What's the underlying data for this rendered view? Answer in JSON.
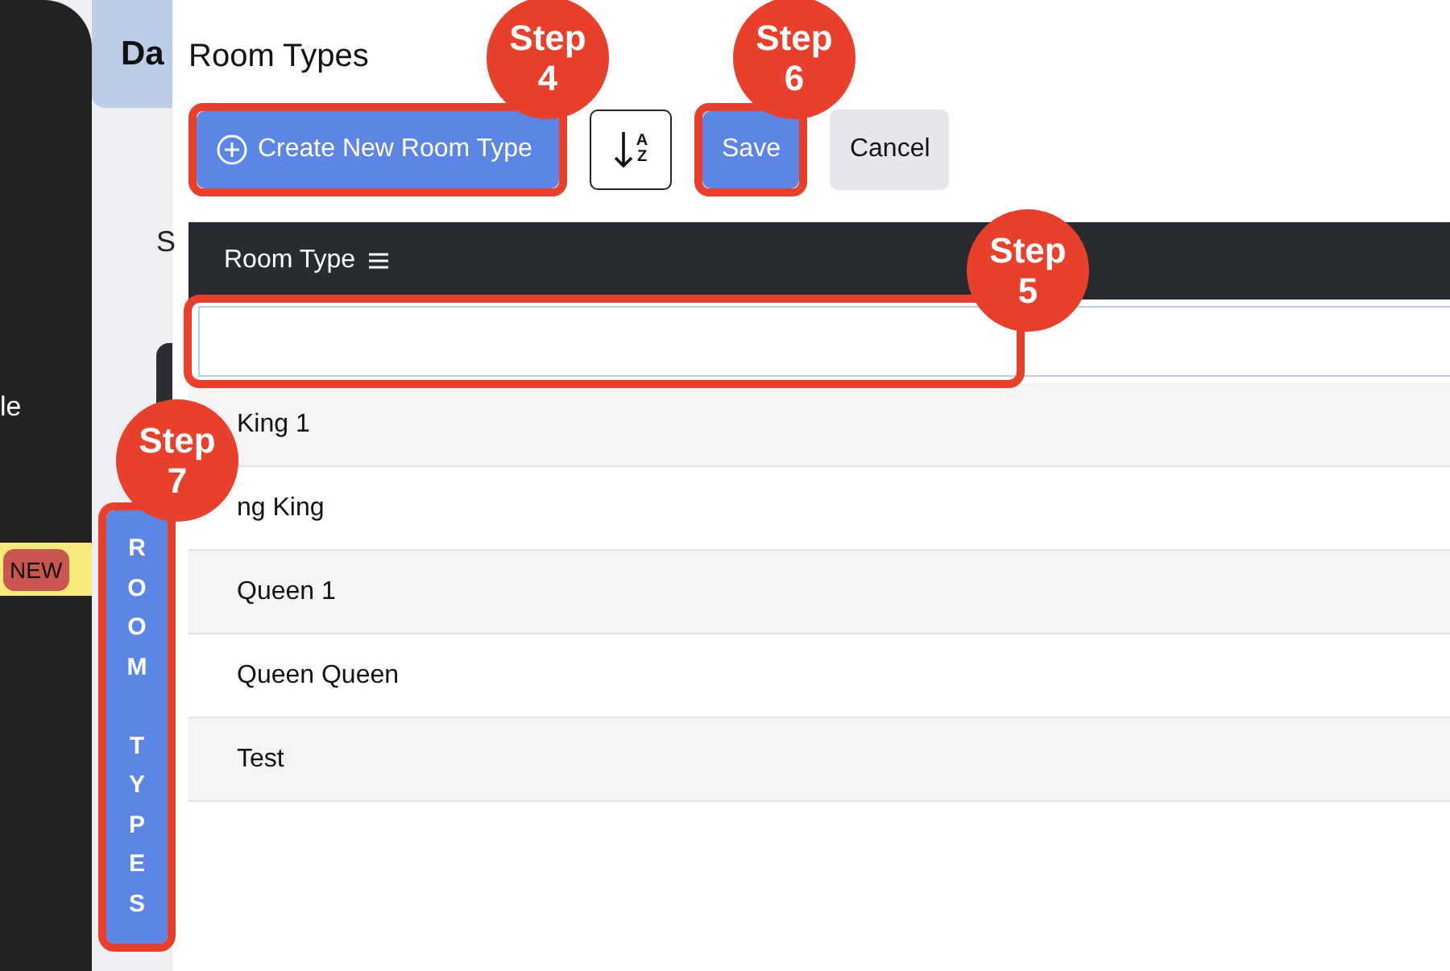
{
  "sidebar": {
    "cut_text": "le",
    "badge": "NEW"
  },
  "back_page": {
    "header": "Da",
    "cut_text": "S",
    "vertical_tab": "ROOM TYPES"
  },
  "dialog": {
    "title": "Room Types",
    "toolbar": {
      "create_button": "Create New Room Type",
      "sort_button": {
        "top": "A",
        "bottom": "Z"
      },
      "save_button": "Save",
      "cancel_button": "Cancel"
    },
    "table": {
      "column": "Room Type",
      "rows": [
        "King 1",
        "ng King",
        "Queen 1",
        "Queen Queen",
        "Test"
      ]
    }
  },
  "step_badges": [
    {
      "label": "Step",
      "number": "4"
    },
    {
      "label": "Step",
      "number": "6"
    },
    {
      "label": "Step",
      "number": "5"
    },
    {
      "label": "Step",
      "number": "7"
    }
  ]
}
